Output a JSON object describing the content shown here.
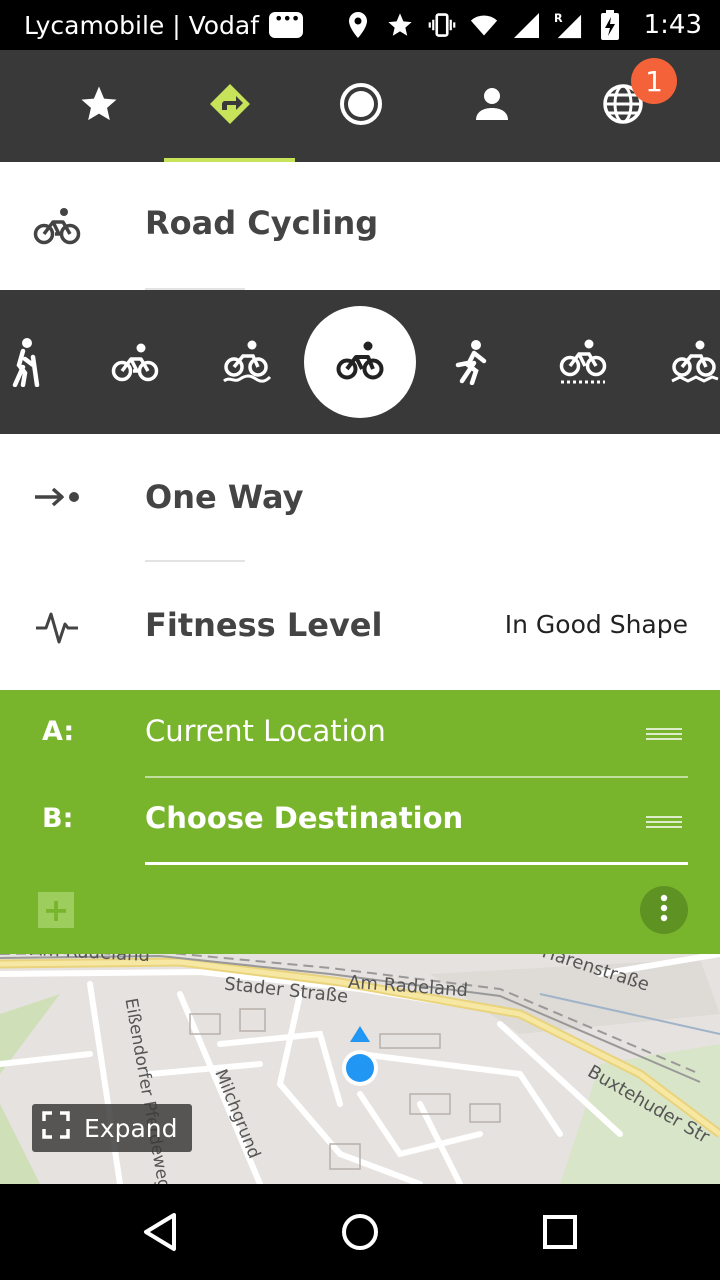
{
  "status_bar": {
    "carrier": "Lycamobile | Vodaf",
    "time": "1:43",
    "icons": [
      "message-icon",
      "location-pin-icon",
      "star-icon",
      "vibrate-icon",
      "wifi-icon",
      "signal-icon",
      "roaming-signal-icon",
      "battery-charging-icon"
    ]
  },
  "top_nav": {
    "tabs": [
      {
        "icon": "star-icon",
        "active": false
      },
      {
        "icon": "route-arrow-icon",
        "active": true
      },
      {
        "icon": "record-icon",
        "active": false
      },
      {
        "icon": "person-icon",
        "active": false
      },
      {
        "icon": "globe-icon",
        "active": false,
        "badge": "1"
      }
    ],
    "accent_color": "#c6e35a"
  },
  "sport": {
    "label": "Road Cycling",
    "icon": "bicycle-icon"
  },
  "activities": [
    {
      "icon": "hiking-icon"
    },
    {
      "icon": "bicycle-icon"
    },
    {
      "icon": "mountain-bike-icon"
    },
    {
      "icon": "road-bike-icon",
      "selected": true
    },
    {
      "icon": "running-icon"
    },
    {
      "icon": "gravel-bike-icon"
    },
    {
      "icon": "mtb-icon"
    }
  ],
  "route_type": {
    "label": "One Way",
    "icon": "one-way-icon"
  },
  "fitness": {
    "label": "Fitness Level",
    "value": "In Good Shape",
    "icon": "pulse-icon"
  },
  "waypoints": {
    "a_letter": "A:",
    "a_value": "Current Location",
    "b_letter": "B:",
    "b_value": "Choose Destination",
    "add": "+",
    "panel_color": "#79b52c"
  },
  "map": {
    "labels": {
      "stader": "Stader Straße",
      "radeland": "Am Radeland",
      "eissendorfer": "Eißendorfer Pferdeweg",
      "milchgrund": "Milchgrund",
      "buxtehuder": "Buxtehuder Str",
      "renstrasse": "Harenstraße",
      "top_left": "Am Radeland"
    },
    "expand_label": "Expand"
  },
  "system_nav": {
    "buttons": [
      "back-icon",
      "home-icon",
      "recents-icon"
    ]
  }
}
